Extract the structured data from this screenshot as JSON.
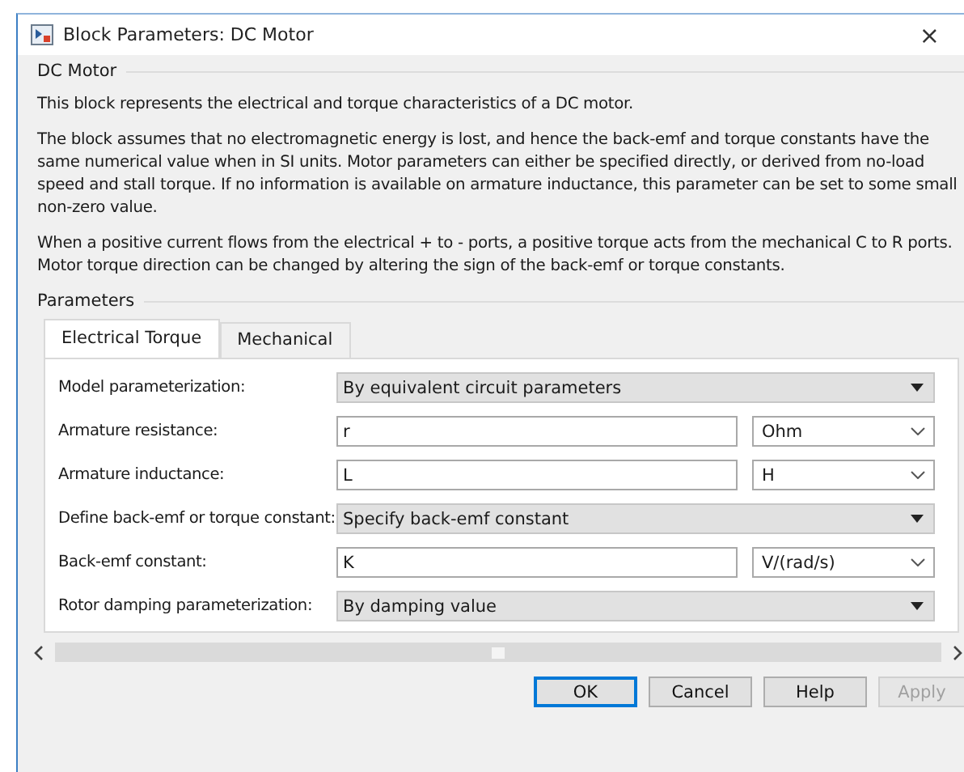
{
  "window": {
    "title": "Block Parameters: DC Motor",
    "close": "×"
  },
  "block": {
    "heading": "DC Motor",
    "paragraphs": [
      "This block represents the electrical and torque characteristics of a DC motor.",
      "The block assumes that no electromagnetic energy is lost, and hence the back-emf and torque constants have the same numerical value when in SI units. Motor parameters can either be specified directly, or derived from no-load speed and stall torque. If no information is available on armature inductance, this parameter can be set to some small non-zero value.",
      "When a positive current flows from the electrical + to - ports, a positive torque acts from the mechanical C to R ports. Motor torque direction can be changed by altering the sign of the back-emf or torque constants."
    ]
  },
  "parameters": {
    "heading": "Parameters",
    "tabs": [
      {
        "label": "Electrical Torque",
        "selected": true
      },
      {
        "label": "Mechanical",
        "selected": false
      }
    ],
    "rows": [
      {
        "kind": "popup",
        "label": "Model parameterization:",
        "value": "By equivalent circuit parameters"
      },
      {
        "kind": "edit",
        "label": "Armature resistance:",
        "value": "r",
        "unit": "Ohm"
      },
      {
        "kind": "edit",
        "label": "Armature inductance:",
        "value": "L",
        "unit": "H"
      },
      {
        "kind": "popup",
        "label": "Define back-emf or torque constant:",
        "value": "Specify back-emf constant"
      },
      {
        "kind": "edit",
        "label": "Back-emf constant:",
        "value": "K",
        "unit": "V/(rad/s)"
      },
      {
        "kind": "popup",
        "label": "Rotor damping parameterization:",
        "value": "By damping value"
      }
    ]
  },
  "buttons": [
    {
      "label": "OK",
      "default": true,
      "disabled": false
    },
    {
      "label": "Cancel",
      "default": false,
      "disabled": false
    },
    {
      "label": "Help",
      "default": false,
      "disabled": false
    },
    {
      "label": "Apply",
      "default": false,
      "disabled": true
    }
  ]
}
